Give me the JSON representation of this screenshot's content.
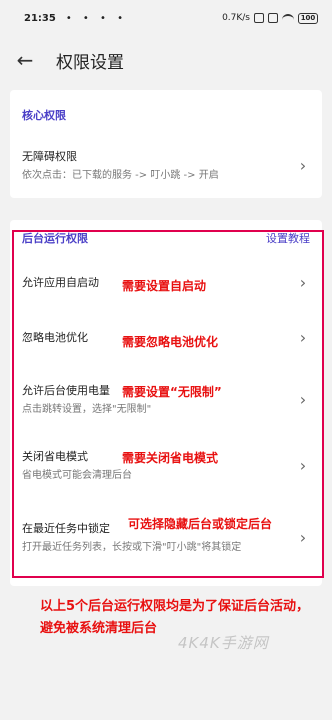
{
  "status_bar": {
    "time": "21:35",
    "dots": "• • • •",
    "speed": "0.7K/s",
    "battery": "100"
  },
  "app_bar": {
    "title": "权限设置"
  },
  "core": {
    "header": "核心权限",
    "items": [
      {
        "title": "无障碍权限",
        "desc": "依次点击：已下载的服务 -> 叮小跳 -> 开启"
      }
    ]
  },
  "background": {
    "header": "后台运行权限",
    "tutorial_link": "设置教程",
    "items": [
      {
        "title": "允许应用自启动",
        "desc": "",
        "note": "需要设置自启动"
      },
      {
        "title": "忽略电池优化",
        "desc": "",
        "note": "需要忽略电池优化"
      },
      {
        "title": "允许后台使用电量",
        "desc": "点击跳转设置，选择\"无限制\"",
        "note": "需要设置“无限制”"
      },
      {
        "title": "关闭省电模式",
        "desc": "省电模式可能会清理后台",
        "note": "需要关闭省电模式"
      },
      {
        "title": "在最近任务中锁定",
        "desc": "打开最近任务列表，长按或下滑\"叮小跳\"将其锁定",
        "note": "可选择隐藏后台或锁定后台"
      }
    ]
  },
  "bottom_note": "以上5个后台运行权限均是为了保证后台活动，避免被系统清理后台",
  "watermark": "4K4K手游网",
  "colors": {
    "accent": "#4a3fc7",
    "annotation": "#e81010",
    "highlight_box": "#e0004d"
  }
}
